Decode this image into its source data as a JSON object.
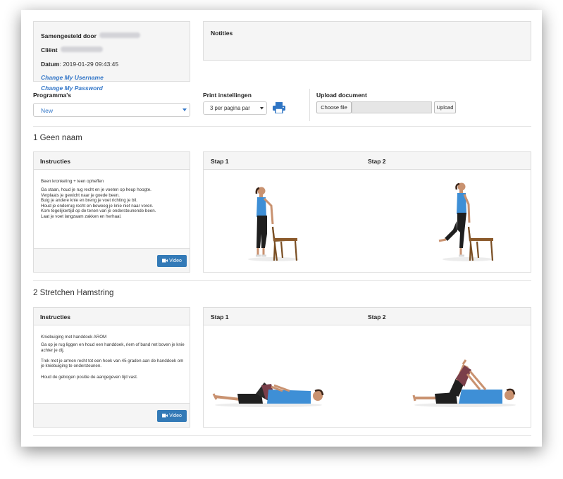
{
  "profile": {
    "composed_by_label": "Samengesteld door",
    "client_label": "Cliënt",
    "date_label": "Datum",
    "date_value": "2019-01-29 09:43:45",
    "change_username": "Change My Username",
    "change_password": "Change My Password"
  },
  "notes": {
    "title": "Notities"
  },
  "program": {
    "label": "Programma's",
    "selected": "New"
  },
  "print": {
    "label": "Print instellingen",
    "selected": "3 per pagina par"
  },
  "upload": {
    "label": "Upload document",
    "choose_file": "Choose file",
    "upload_button": "Upload"
  },
  "exercises": [
    {
      "title": "1 Geen naam",
      "instructions_header": "Instructies",
      "instructions_title": "Been kronkeling + teen opheffen",
      "instructions_body": "Ga staan, houd je rug recht en je voeten op heup hoogte.\nVerplaats je gewicht naar je goede been.\nBuig je andere knie en breng je voet richting je bil.\nHoud je onderrug recht en beweeg je knie niet naar voren.\nKom tegelijkertijd op de tenen van je ondersteunende been.\nLaat je voet langzaam zakken en herhaal.",
      "video_label": "Video",
      "step1": "Stap 1",
      "step2": "Stap 2"
    },
    {
      "title": "2 Stretchen Hamstring",
      "instructions_header": "Instructies",
      "instructions_title": "Kniebuiging met handdoek AROM",
      "instructions_body": "Ga op je rug liggen en houd een handdoek, riem of band net boven je knie achter je dij.\n\nTrek met je armen recht tot een hoek van 45 graden aan de handdoek om je kniebuiging te ondersteunen.\n\nHoud de gebogen positie de aangegeven tijd vast.",
      "video_label": "Video",
      "step1": "Stap 1",
      "step2": "Stap 2"
    }
  ],
  "colors": {
    "link": "#3477c8",
    "button_primary": "#337ab7",
    "shirt": "#3e8fd6"
  },
  "icons": {
    "print": "printer-icon",
    "dropdown": "caret-down-icon",
    "video": "video-camera-icon"
  }
}
